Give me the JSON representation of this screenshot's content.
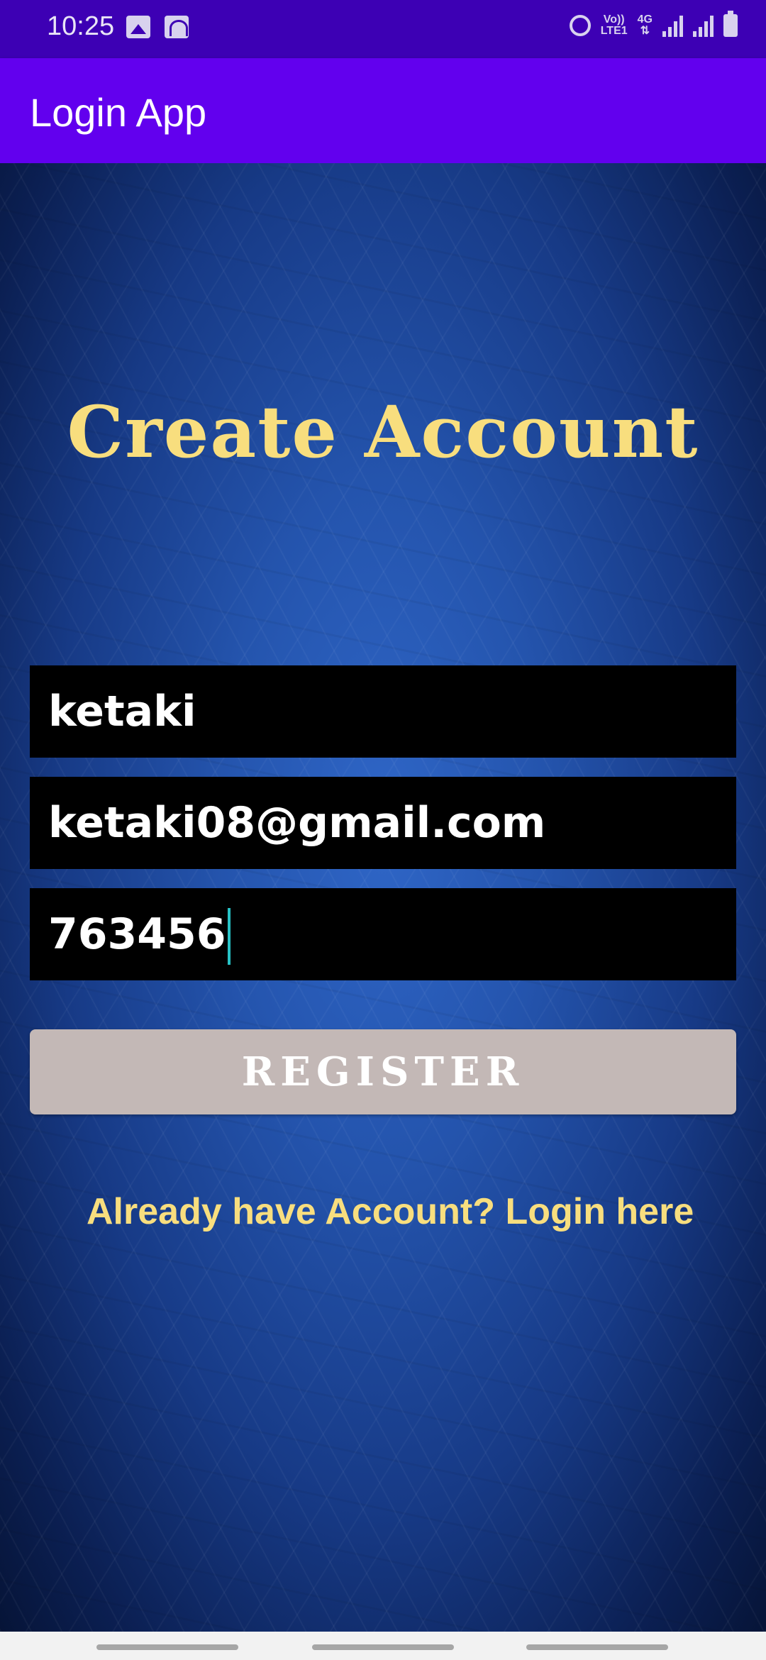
{
  "status_bar": {
    "time": "10:25",
    "volte": "Vo))",
    "lte": "LTE1",
    "network": "4G",
    "icons": [
      "gallery-icon",
      "wifi-calling-icon",
      "alarm-icon",
      "signal-icon",
      "battery-icon"
    ]
  },
  "app_bar": {
    "title": "Login App"
  },
  "form": {
    "heading": "Create Account",
    "username": "ketaki",
    "email": "ketaki08@gmail.com",
    "password": "763456",
    "register_label": "REGISTER",
    "login_link": "Already have Account? Login here"
  },
  "colors": {
    "status_bar": "#3d00b4",
    "app_bar": "#6200ee",
    "heading": "#f8de7e",
    "field_bg": "#000000",
    "button_bg": "#c3b8b6",
    "cursor": "#27c2c6"
  }
}
